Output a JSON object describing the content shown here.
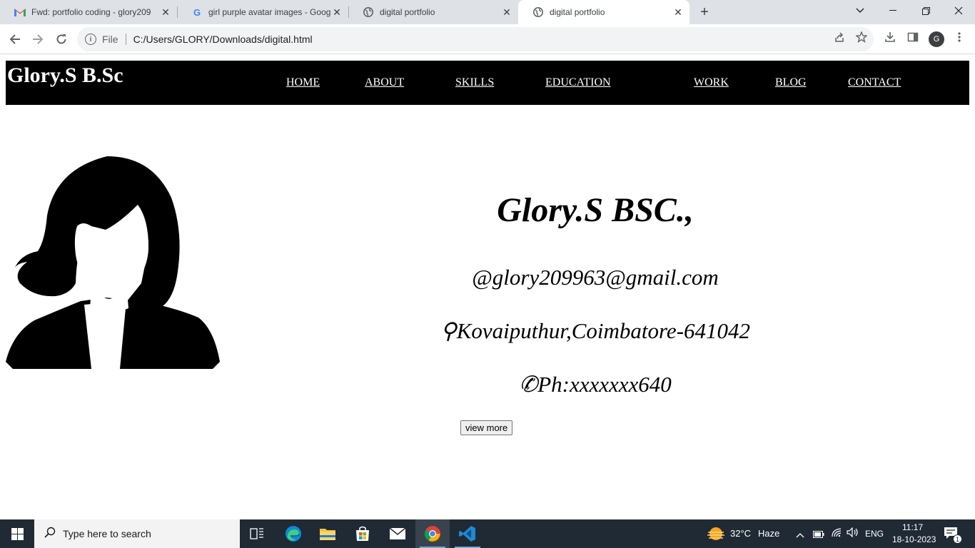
{
  "browser": {
    "tabs": [
      {
        "title": "Fwd: portfolio coding - glory209",
        "icon": "gmail-icon",
        "active": false
      },
      {
        "title": "girl purple avatar images - Goog",
        "icon": "google-icon",
        "active": false
      },
      {
        "title": "digital portfolio",
        "icon": "globe-icon",
        "active": false
      },
      {
        "title": "digital portfolio",
        "icon": "globe-icon",
        "active": true
      }
    ],
    "address": {
      "scheme": "File",
      "url": "C:/Users/GLORY/Downloads/digital.html"
    },
    "profile_initial": "G"
  },
  "page": {
    "brand": "Glory.S B.Sc",
    "nav": [
      "HOME",
      "ABOUT",
      "SKILLS",
      "EDUCATION",
      "WORK",
      "BLOG",
      "CONTACT"
    ],
    "name": "Glory.S BSC.,",
    "email": "@glory209963@gmail.com",
    "location": "⚲Kovaiputhur,Coimbatore-641042",
    "phone": "✆Ph:xxxxxxx640",
    "view_more_label": "view more"
  },
  "taskbar": {
    "search_placeholder": "Type here to search",
    "weather": {
      "temp": "32°C",
      "condition": "Haze"
    },
    "language": "ENG",
    "time": "11:17",
    "date": "18-10-2023",
    "notification_count": "1"
  },
  "colors": {
    "nav_bg": "#000000",
    "taskbar_bg": "#202a35",
    "tabstrip_bg": "#dee1e6"
  }
}
